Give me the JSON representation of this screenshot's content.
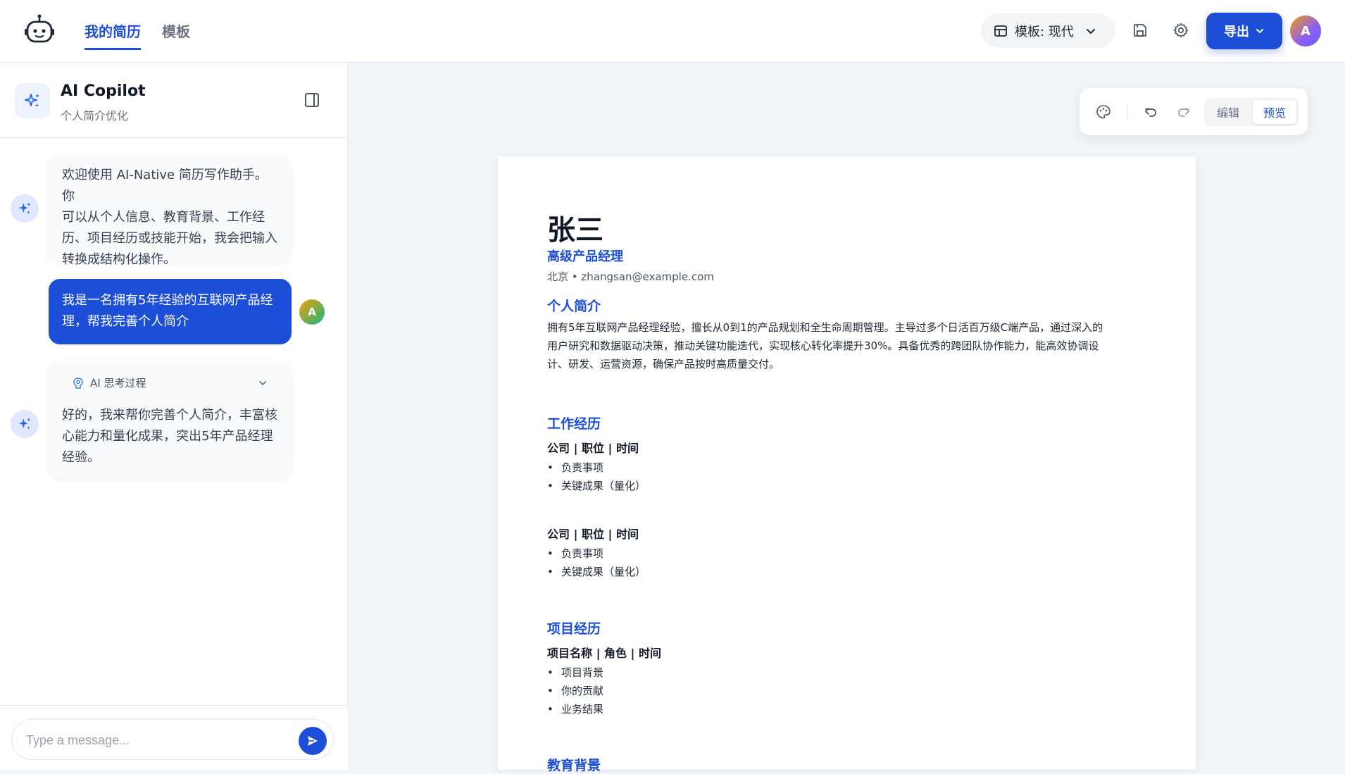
{
  "header": {
    "tabs": [
      {
        "label": "我的简历",
        "active": true
      },
      {
        "label": "模板",
        "active": false
      }
    ],
    "template_select": "模板: 现代",
    "export_label": "导出",
    "avatar_initial": "A",
    "accent": "#1d4ed8"
  },
  "sidebar": {
    "title": "AI Copilot",
    "subtitle": "个人简介优化",
    "messages": [
      {
        "role": "ai",
        "lines": [
          "欢迎使用 AI-Native 简历写作助手。你",
          "可以从个人信息、教育背景、工作经",
          "历、项目经历或技能开始，我会把输入",
          "转换成结构化操作。"
        ]
      },
      {
        "role": "user",
        "lines": [
          "我是一名拥有5年经验的互联网产品经",
          "理，帮我完善个人简介"
        ],
        "avatar": "A"
      },
      {
        "role": "ai",
        "thinking_label": "AI 思考过程",
        "lines": [
          "好的，我来帮你完善个人简介，丰富核",
          "心能力和量化成果，突出5年产品经理",
          "经验。"
        ]
      }
    ],
    "input_placeholder": "Type a message..."
  },
  "toolbar": {
    "edit_label": "编辑",
    "preview_label": "预览",
    "active_mode": "preview"
  },
  "resume": {
    "name": "张三",
    "title": "高级产品经理",
    "contact": "北京 • zhangsan@example.com",
    "summary_heading": "个人简介",
    "summary_lines": [
      "拥有5年互联网产品经理经验，擅长从0到1的产品规划和全生命周期管理。主导过多个日活百万级C端产品，通过深入的",
      "用户研究和数据驱动决策，推动关键功能迭代，实现核心转化率提升30%。具备优秀的跨团队协作能力，能高效协调设",
      "计、研发、运营资源，确保产品按时高质量交付。"
    ],
    "work_heading": "工作经历",
    "work_entries": [
      {
        "title": "公司 | 职位 | 时间",
        "bullets": [
          "负责事项",
          "关键成果（量化）"
        ]
      },
      {
        "title": "公司 | 职位 | 时间",
        "bullets": [
          "负责事项",
          "关键成果（量化）"
        ]
      }
    ],
    "project_heading": "项目经历",
    "project_entry": {
      "title": "项目名称 | 角色 | 时间",
      "bullets": [
        "项目背景",
        "你的贡献",
        "业务结果"
      ]
    },
    "education_heading": "教育背景"
  }
}
